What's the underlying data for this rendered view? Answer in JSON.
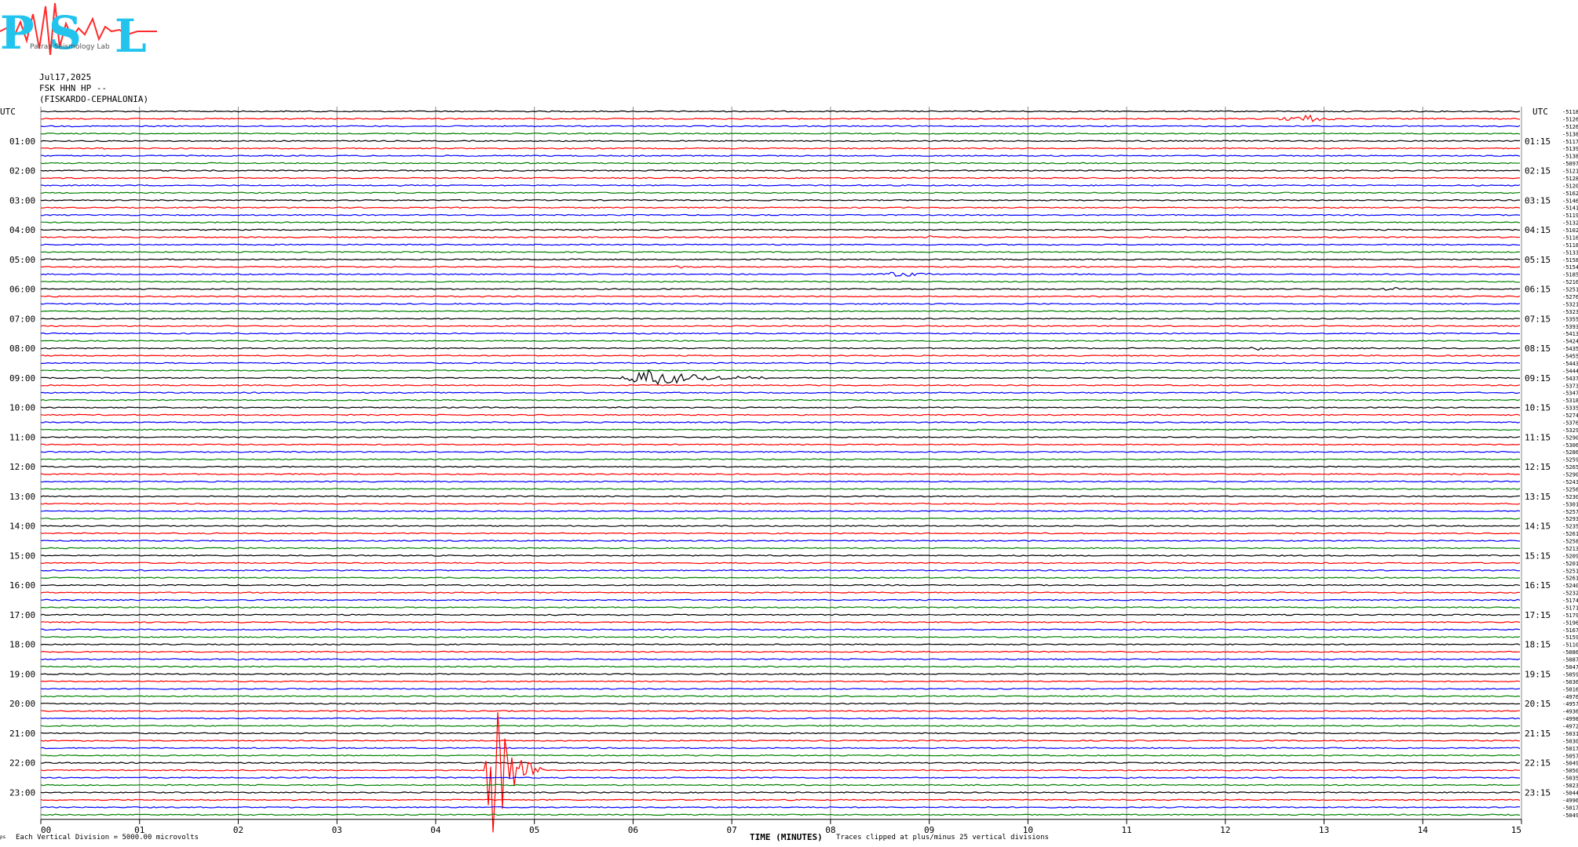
{
  "logo": {
    "letters": "PSL",
    "subtitle": "Patras Seismology Lab",
    "colors": {
      "letters": "#22c4ee",
      "wave": "#ff2a2a"
    }
  },
  "header": {
    "date": "Jul17,2025",
    "station": "FSK HHN HP --",
    "location": "(FISKARDO-CEPHALONIA)"
  },
  "footer": {
    "mark": "ps",
    "scale": "Each Vertical Division = 5000.00 microvolts",
    "clip_note": "Traces clipped at plus/minus 25 vertical divisions"
  },
  "chart_data": {
    "type": "line",
    "title": "",
    "xlabel": "TIME (MINUTES)",
    "left_axis_title": "UTC",
    "right_axis_title": "UTC",
    "x_ticks": [
      "00",
      "01",
      "02",
      "03",
      "04",
      "05",
      "06",
      "07",
      "08",
      "09",
      "10",
      "11",
      "12",
      "13",
      "14",
      "15"
    ],
    "xlim": [
      0,
      15
    ],
    "rows_per_hour": 4,
    "minutes_per_row": 15,
    "trace_colors": [
      "#000000",
      "#ff0000",
      "#0000ff",
      "#008000"
    ],
    "grid": true,
    "left_labels": [
      "01:00",
      "02:00",
      "03:00",
      "04:00",
      "05:00",
      "06:00",
      "07:00",
      "08:00",
      "09:00",
      "10:00",
      "11:00",
      "12:00",
      "13:00",
      "14:00",
      "15:00",
      "16:00",
      "17:00",
      "18:00",
      "19:00",
      "20:00",
      "21:00",
      "22:00",
      "23:00"
    ],
    "right_labels": [
      "01:15",
      "02:15",
      "03:15",
      "04:15",
      "05:15",
      "06:15",
      "07:15",
      "08:15",
      "09:15",
      "10:15",
      "11:15",
      "12:15",
      "13:15",
      "14:15",
      "15:15",
      "16:15",
      "17:15",
      "18:15",
      "19:15",
      "20:15",
      "21:15",
      "22:15",
      "23:15"
    ],
    "row_values": [
      "-5118",
      "-5126",
      "-5126",
      "-5138",
      "-5117",
      "-5139",
      "-5138",
      "-5097",
      "-5121",
      "-5128",
      "-5120",
      "-5162",
      "-5146",
      "-5141",
      "-5119",
      "-5132",
      "-5102",
      "-5116",
      "-5118",
      "-5133",
      "-5158",
      "-5154",
      "-5185",
      "-5216",
      "-5251",
      "-5276",
      "-5321",
      "-5323",
      "-5355",
      "-5393",
      "-5413",
      "-5424",
      "-5435",
      "-5455",
      "-5443",
      "-5444",
      "-5437",
      "-5373",
      "-5347",
      "-5318",
      "-5335",
      "-5274",
      "-5376",
      "-5329",
      "-5290",
      "-5306",
      "-5286",
      "-5259",
      "-5265",
      "-5290",
      "-5243",
      "-5256",
      "-5230",
      "-5301",
      "-5257",
      "-5293",
      "-5235",
      "-5261",
      "-5258",
      "-5213",
      "-5209",
      "-5201",
      "-5251",
      "-5261",
      "-5240",
      "-5232",
      "-5174",
      "-5171",
      "-5179",
      "-5196",
      "-5167",
      "-5159",
      "-5110",
      "-5086",
      "-5087",
      "-5047",
      "-5059",
      "-5036",
      "-5016",
      "-4976",
      "-4957",
      "-4936",
      "-4998",
      "-4972",
      "-5031",
      "-5030",
      "-5017",
      "-5057",
      "-5049",
      "-5050",
      "-5035",
      "-5023",
      "-5044",
      "-4996",
      "-5017",
      "-5049"
    ],
    "events": [
      {
        "row": 1,
        "minute_start": 12.45,
        "minute_end": 13.3,
        "peak_minute": 12.85,
        "amplitude_div": 0.6
      },
      {
        "row": 5,
        "minute_start": 0.55,
        "minute_end": 0.72,
        "peak_minute": 0.62,
        "amplitude_div": 0.2
      },
      {
        "row": 17,
        "minute_start": 8.9,
        "minute_end": 9.2,
        "peak_minute": 9.0,
        "amplitude_div": 0.25
      },
      {
        "row": 21,
        "minute_start": 6.4,
        "minute_end": 6.55,
        "peak_minute": 6.45,
        "amplitude_div": 0.45
      },
      {
        "row": 22,
        "minute_start": 8.45,
        "minute_end": 9.0,
        "peak_minute": 8.75,
        "amplitude_div": 0.5
      },
      {
        "row": 24,
        "minute_start": 13.55,
        "minute_end": 13.95,
        "peak_minute": 13.7,
        "amplitude_div": 0.35
      },
      {
        "row": 32,
        "minute_start": 12.2,
        "minute_end": 12.5,
        "peak_minute": 12.35,
        "amplitude_div": 0.25
      },
      {
        "row": 36,
        "minute_start": 5.85,
        "minute_end": 7.6,
        "peak_minute": 6.15,
        "amplitude_div": 1.2
      },
      {
        "row": 89,
        "minute_start": 4.5,
        "minute_end": 5.1,
        "peak_minute": 4.58,
        "amplitude_div": 13.0
      }
    ]
  }
}
